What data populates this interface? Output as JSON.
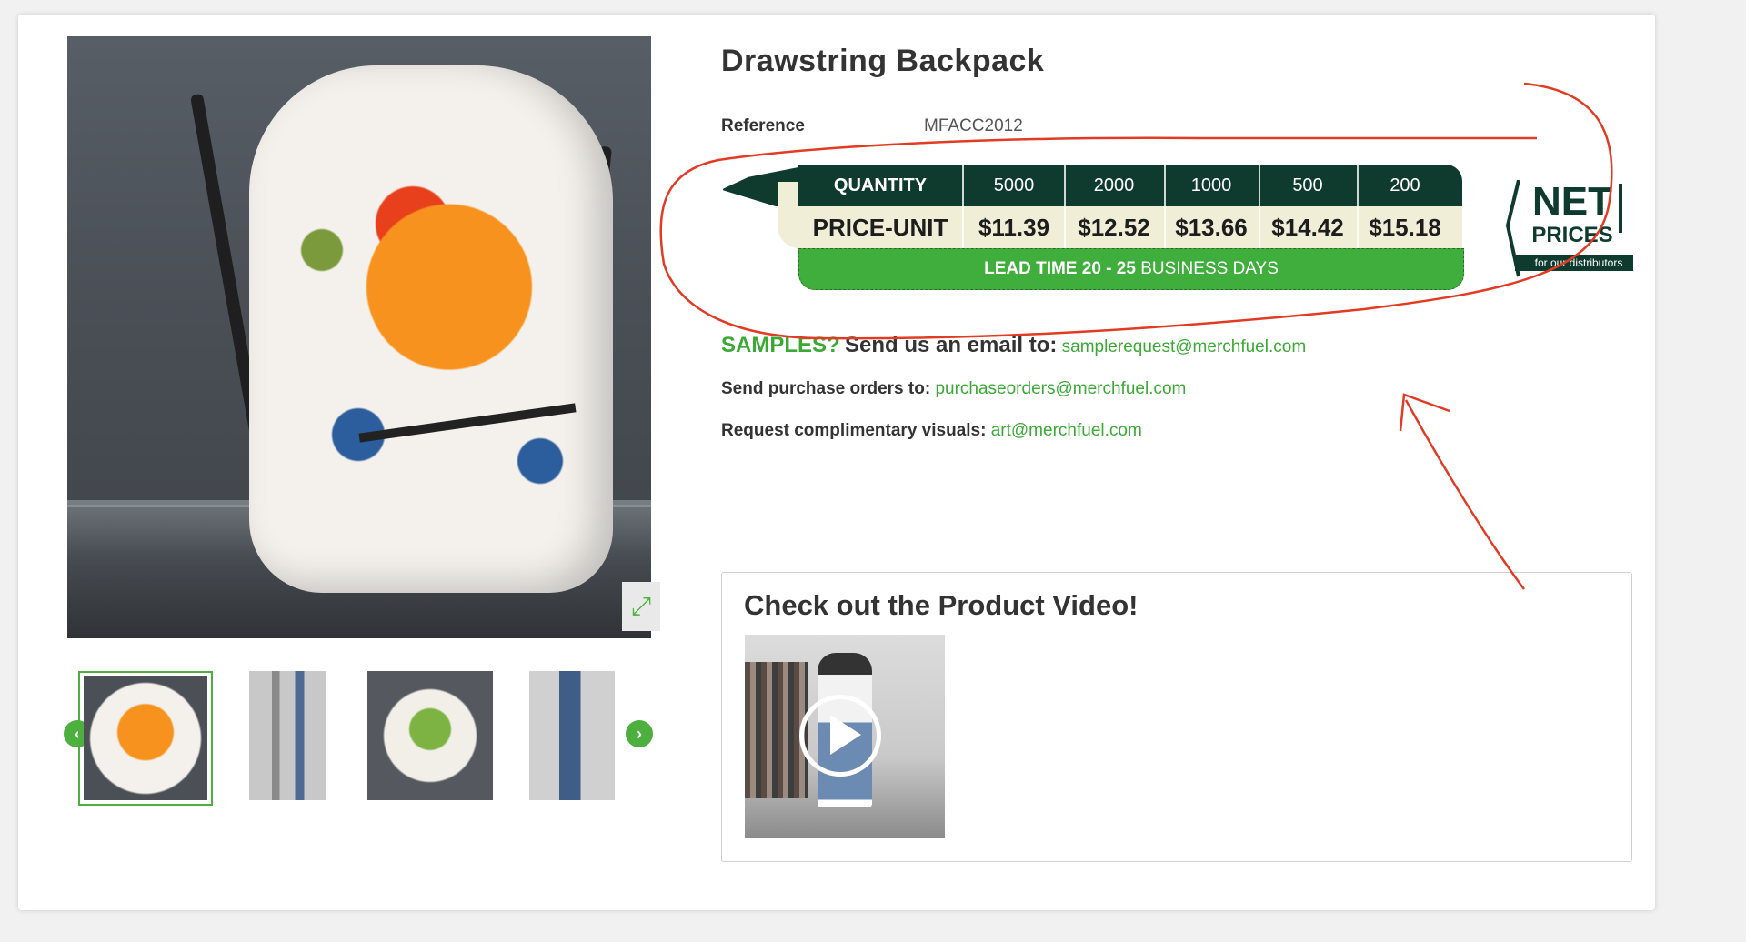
{
  "product": {
    "title": "Drawstring Backpack",
    "reference_label": "Reference",
    "reference_value": "MFACC2012"
  },
  "price_table": {
    "quantity_label": "QUANTITY",
    "price_label": "PRICE-UNIT",
    "quantities": [
      "5000",
      "2000",
      "1000",
      "500",
      "200"
    ],
    "prices": [
      "$11.39",
      "$12.52",
      "$13.66",
      "$14.42",
      "$15.18"
    ],
    "lead_time_bold": "LEAD TIME 20 - 25",
    "lead_time_rest": "BUSINESS DAYS",
    "colors": {
      "dark": "#0f3b2f",
      "cream": "#f1eed8",
      "green": "#3fae3d"
    }
  },
  "net_badge": {
    "line1": "NET",
    "line2": "PRICES",
    "sub": "for our distributors"
  },
  "contact": {
    "samples_q": "SAMPLES?",
    "samples_text": "Send us an email to:",
    "samples_email": "samplerequest@merchfuel.com",
    "po_label": "Send purchase orders to:",
    "po_email": "purchaseorders@merchfuel.com",
    "visuals_label": "Request complimentary visuals:",
    "visuals_email": "art@merchfuel.com"
  },
  "video": {
    "title": "Check out the Product Video!"
  },
  "gallery": {
    "prev_icon": "chevron-left-icon",
    "next_icon": "chevron-right-icon",
    "expand_icon": "expand-icon"
  },
  "accent_color": "#3aaa35",
  "annotation_color": "#e23b24"
}
